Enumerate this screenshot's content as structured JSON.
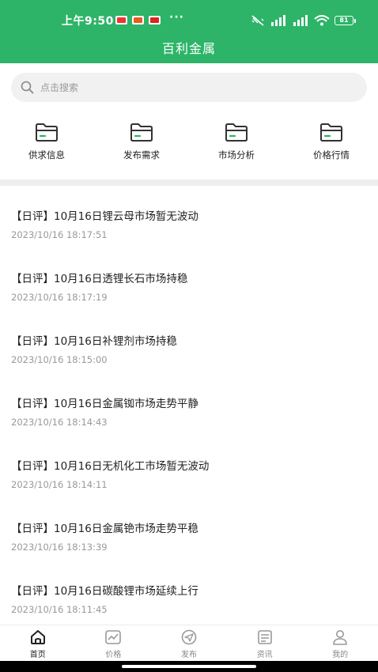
{
  "status_bar": {
    "time": "上午9:50",
    "more": "···",
    "battery": "81"
  },
  "header": {
    "title": "百利金属"
  },
  "search": {
    "placeholder": "点击搜索"
  },
  "categories": [
    {
      "label": "供求信息",
      "icon": "folder-icon"
    },
    {
      "label": "发布需求",
      "icon": "folder-icon"
    },
    {
      "label": "市场分析",
      "icon": "folder-icon"
    },
    {
      "label": "价格行情",
      "icon": "folder-icon"
    }
  ],
  "news": [
    {
      "title": "【日评】10月16日锂云母市场暂无波动",
      "time": "2023/10/16 18:17:51"
    },
    {
      "title": "【日评】10月16日透锂长石市场持稳",
      "time": "2023/10/16 18:17:19"
    },
    {
      "title": "【日评】10月16日补锂剂市场持稳",
      "time": "2023/10/16 18:15:00"
    },
    {
      "title": "【日评】10月16日金属铷市场走势平静",
      "time": "2023/10/16 18:14:43"
    },
    {
      "title": "【日评】10月16日无机化工市场暂无波动",
      "time": "2023/10/16 18:14:11"
    },
    {
      "title": "【日评】10月16日金属铯市场走势平稳",
      "time": "2023/10/16 18:13:39"
    },
    {
      "title": "【日评】10月16日碳酸锂市场延续上行",
      "time": "2023/10/16 18:11:45"
    }
  ],
  "tabbar": {
    "items": [
      {
        "label": "首页",
        "icon": "home-icon",
        "active": true
      },
      {
        "label": "价格",
        "icon": "chart-icon",
        "active": false
      },
      {
        "label": "发布",
        "icon": "send-icon",
        "active": false
      },
      {
        "label": "资讯",
        "icon": "news-icon",
        "active": false
      },
      {
        "label": "我的",
        "icon": "user-icon",
        "active": false
      }
    ]
  },
  "colors": {
    "brand": "#2db468",
    "accent_green": "#2db468"
  }
}
